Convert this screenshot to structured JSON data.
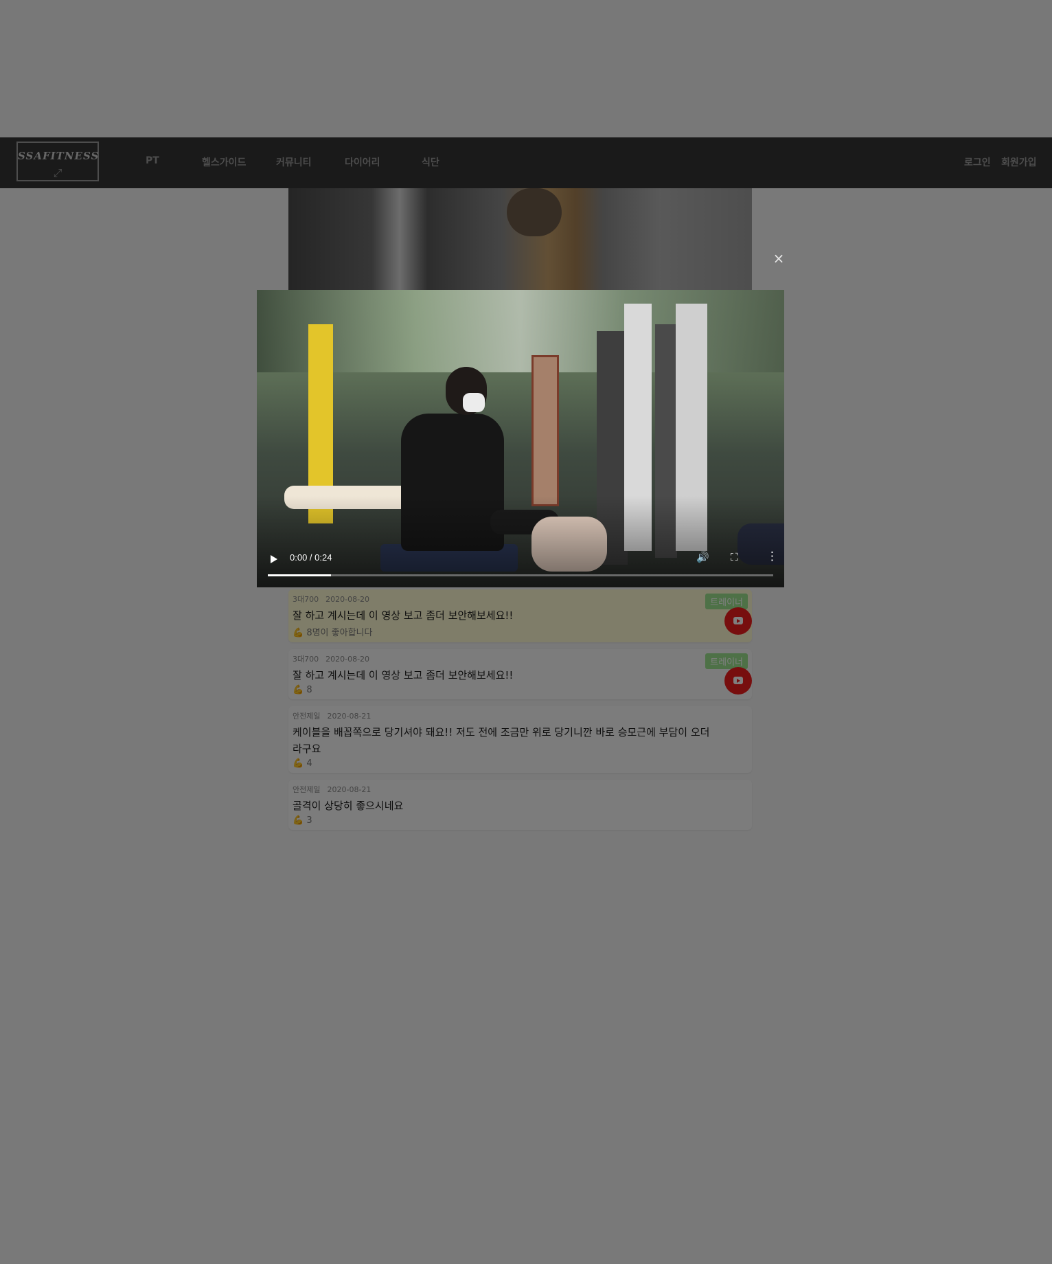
{
  "nav": {
    "logo_text": "SSAFITNESS",
    "items": [
      {
        "label": "PT"
      },
      {
        "label": "헬스가이드"
      },
      {
        "label": "커뮤니티"
      },
      {
        "label": "다이어리"
      },
      {
        "label": "식단"
      }
    ],
    "login": "로그인",
    "signup": "회원가입"
  },
  "video": {
    "time": "0:00 / 0:24",
    "progress_fraction": 0.125,
    "icons": [
      "play-icon",
      "volume-icon",
      "fullscreen-icon",
      "more-options-icon"
    ]
  },
  "modal": {
    "close_icon": "close-icon",
    "close_glyph": "×"
  },
  "comments": [
    {
      "author": "3대700",
      "date": "2020-08-20",
      "text": "잘 하고 계시는데 이 영상 보고 좀더 보안해보세요!!",
      "likes": "8명이 좋아합니다",
      "badge": "트레이너",
      "highlight": true,
      "has_video_link": true
    },
    {
      "author": "3대700",
      "date": "2020-08-20",
      "text": "잘 하고 계시는데 이 영상 보고 좀더 보안해보세요!!",
      "likes": "8",
      "badge": "트레이너",
      "highlight": false,
      "has_video_link": true
    },
    {
      "author": "안전제일",
      "date": "2020-08-21",
      "text": "케이블을 배꼽쪽으로 당기셔야 돼요!! 저도 전에 조금만 위로 당기니깐 바로 승모근에 부담이 오더라구요",
      "likes": "4",
      "badge": "",
      "highlight": false,
      "has_video_link": false
    },
    {
      "author": "안전제일",
      "date": "2020-08-21",
      "text": "골격이 상당히 좋으시네요",
      "likes": "3",
      "badge": "",
      "highlight": false,
      "has_video_link": false
    }
  ],
  "colors": {
    "navbar_bg": "#343434",
    "badge_bg": "#9ce28f",
    "youtube_red": "#ee1c1c",
    "highlight_bg": "#fffbd2",
    "overlay": "rgba(0,0,0,0.5)"
  }
}
